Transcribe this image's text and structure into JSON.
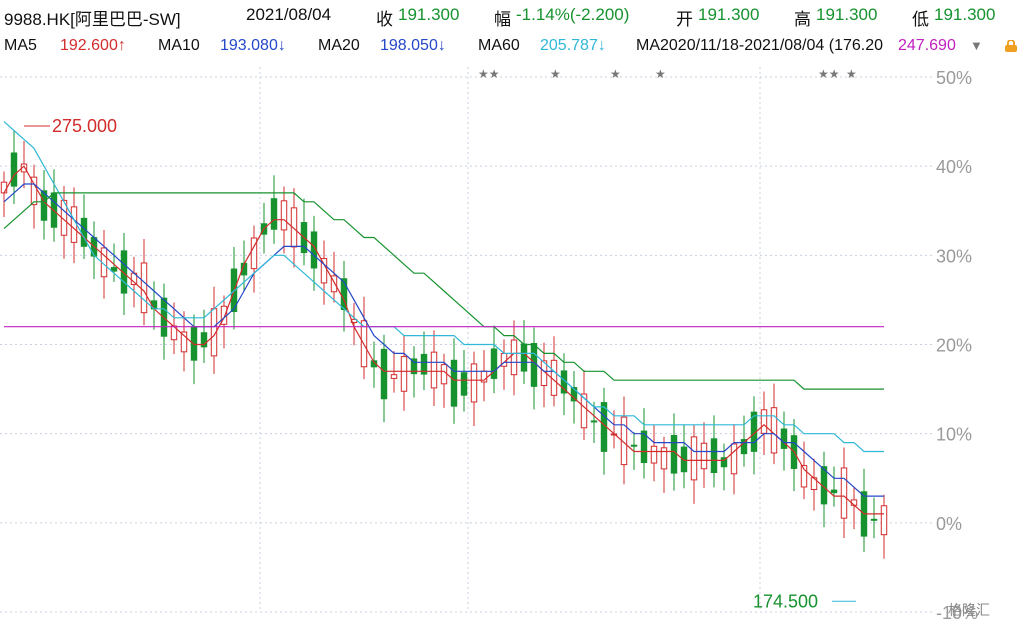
{
  "header": {
    "symbol": "9988.HK[阿里巴巴-SW]",
    "date": "2021/08/04",
    "close_label": "收",
    "close_value": "191.300",
    "change_label": "幅",
    "change_value": "-1.14%(-2.200)",
    "open_label": "开",
    "open_value": "191.300",
    "high_label": "高",
    "high_value": "191.300",
    "low_label": "低",
    "low_value": "191.300"
  },
  "ma_row": {
    "ma5_label": "MA5",
    "ma5_value": "192.600↑",
    "ma10_label": "MA10",
    "ma10_value": "193.080↓",
    "ma20_label": "MA20",
    "ma20_value": "198.050↓",
    "ma60_label": "MA60",
    "ma60_value": "205.787↓",
    "overlap_text": "MA2020/11/18-2021/08/04 (176.20",
    "overlap_value": "247.690"
  },
  "brand_text": "格隆汇",
  "colors": {
    "up": "#d22c2c",
    "down": "#16922e",
    "ma5": "#d22c2c",
    "ma10": "#2448c8",
    "ma20": "#2fb8d8",
    "ma60": "#16922e",
    "ma250": "#c020c0",
    "grid": "#c8d0e0"
  },
  "chart_data": {
    "type": "candlestick",
    "y_axis": {
      "ticks": [
        "50%",
        "40%",
        "30%",
        "20%",
        "10%",
        "0%",
        "-10%"
      ],
      "range_percent": [
        -10,
        50
      ],
      "gridlines": "dashed"
    },
    "annotations": {
      "high_label": "275.000",
      "low_label": "174.500"
    },
    "stars": [
      "★★",
      "★",
      "★",
      "★",
      "★★",
      "★"
    ],
    "series": [
      {
        "name": "MA5",
        "role": "ma5",
        "values_percent": [
          37,
          39,
          40,
          38,
          36,
          35,
          34,
          33,
          32,
          31,
          30,
          29,
          28,
          27,
          26,
          24,
          23,
          22,
          21,
          20,
          20,
          21,
          23,
          26,
          29,
          31,
          33,
          34,
          34,
          33,
          32,
          31,
          29,
          27,
          25,
          22,
          20,
          18,
          17,
          17,
          17,
          17,
          17,
          17,
          17,
          16,
          16,
          16,
          16,
          17,
          18,
          19,
          19,
          18,
          17,
          16,
          15,
          14,
          13,
          12,
          11,
          10,
          9,
          8,
          8,
          8,
          8,
          8,
          7,
          7,
          7,
          7,
          7,
          8,
          9,
          10,
          11,
          10,
          9,
          8,
          6,
          5,
          4,
          3,
          3,
          2,
          1,
          1,
          1
        ]
      },
      {
        "name": "MA10",
        "role": "ma10",
        "values_percent": [
          36,
          37,
          38,
          38,
          37,
          36,
          35,
          34,
          33,
          32,
          31,
          30,
          29,
          28,
          27,
          26,
          25,
          24,
          23,
          22,
          22,
          22,
          23,
          24,
          26,
          28,
          29,
          30,
          31,
          31,
          31,
          30,
          29,
          28,
          27,
          25,
          23,
          21,
          20,
          19,
          19,
          18,
          18,
          18,
          18,
          17,
          17,
          17,
          17,
          17,
          18,
          18,
          18,
          18,
          17,
          17,
          16,
          15,
          14,
          13,
          12,
          11,
          11,
          10,
          10,
          9,
          9,
          9,
          9,
          8,
          8,
          8,
          8,
          9,
          9,
          9,
          10,
          10,
          9,
          9,
          8,
          7,
          6,
          5,
          5,
          4,
          3,
          3,
          3
        ]
      },
      {
        "name": "MA20",
        "role": "ma20",
        "values_percent": [
          45,
          44,
          43,
          42,
          40,
          38,
          36,
          34,
          32,
          30,
          29,
          28,
          27,
          26,
          25,
          24,
          24,
          23,
          23,
          23,
          23,
          24,
          25,
          26,
          27,
          28,
          29,
          30,
          30,
          29,
          28,
          27,
          26,
          25,
          24,
          23,
          22,
          22,
          22,
          22,
          21,
          21,
          21,
          21,
          21,
          21,
          20,
          20,
          20,
          20,
          19,
          19,
          19,
          19,
          18,
          17,
          16,
          15,
          14,
          13,
          13,
          12,
          12,
          12,
          11,
          11,
          11,
          11,
          11,
          11,
          11,
          11,
          11,
          11,
          11,
          12,
          12,
          12,
          11,
          11,
          10,
          10,
          10,
          10,
          9,
          9,
          8,
          8,
          8
        ]
      },
      {
        "name": "MA60",
        "role": "ma60",
        "values_percent": [
          33,
          34,
          35,
          36,
          36,
          37,
          37,
          37,
          37,
          37,
          37,
          37,
          37,
          37,
          37,
          37,
          37,
          37,
          37,
          37,
          37,
          37,
          37,
          37,
          37,
          37,
          37,
          37,
          37,
          37,
          36,
          36,
          35,
          34,
          34,
          33,
          32,
          32,
          31,
          30,
          29,
          28,
          28,
          27,
          26,
          25,
          24,
          23,
          22,
          22,
          21,
          21,
          20,
          20,
          19,
          19,
          18,
          18,
          17,
          17,
          17,
          16,
          16,
          16,
          16,
          16,
          16,
          16,
          16,
          16,
          16,
          16,
          16,
          16,
          16,
          16,
          16,
          16,
          16,
          16,
          15,
          15,
          15,
          15,
          15,
          15,
          15,
          15,
          15
        ]
      },
      {
        "name": "MA250",
        "role": "ma250",
        "values_percent": [
          22,
          22,
          22,
          22,
          22,
          22,
          22,
          22,
          22,
          22,
          22,
          22,
          22,
          22,
          22,
          22,
          22,
          22,
          22,
          22,
          22,
          22,
          22,
          22,
          22,
          22,
          22,
          22,
          22,
          22,
          22,
          22,
          22,
          22,
          22,
          22,
          22,
          22,
          22,
          22,
          22,
          22,
          22,
          22,
          22,
          22,
          22,
          22,
          22,
          22,
          22,
          22,
          22,
          22,
          22,
          22,
          22,
          22,
          22,
          22,
          22,
          22,
          22,
          22,
          22,
          22,
          22,
          22,
          22,
          22,
          22,
          22,
          22,
          22,
          22,
          22,
          22,
          22,
          22,
          22,
          22,
          22,
          22,
          22,
          22,
          22,
          22,
          22,
          22
        ]
      }
    ]
  }
}
